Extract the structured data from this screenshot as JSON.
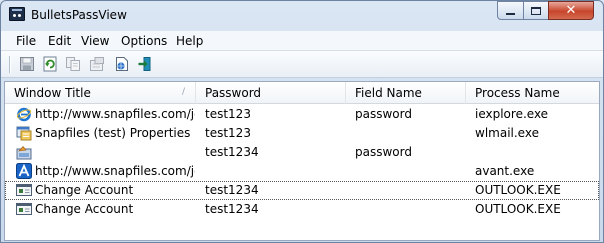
{
  "window": {
    "title": "BulletsPassView"
  },
  "title_controls": {
    "close_glyph": "✕"
  },
  "menu": [
    "File",
    "Edit",
    "View",
    "Options",
    "Help"
  ],
  "toolbar": {
    "buttons": [
      "save-icon",
      "refresh-icon",
      "copy-icon",
      "properties-icon",
      "html-report-icon",
      "exit-icon"
    ]
  },
  "table": {
    "columns": [
      "Window Title",
      "Password",
      "Field Name",
      "Process Name"
    ],
    "sort_indicator": "/",
    "rows": [
      {
        "icon": "internet-explorer-icon",
        "title": "http://www.snapfiles.com/jo...",
        "password": "test123",
        "field": "password",
        "process": "iexplore.exe"
      },
      {
        "icon": "properties-window-icon",
        "title": "Snapfiles (test) Properties",
        "password": "test123",
        "field": "",
        "process": "wlmail.exe"
      },
      {
        "icon": "generic-app-icon",
        "title": "",
        "password": "test1234",
        "field": "password",
        "process": ""
      },
      {
        "icon": "avant-browser-icon",
        "title": "http://www.snapfiles.com/jo...",
        "password": "",
        "field": "",
        "process": "avant.exe"
      },
      {
        "icon": "dialog-window-icon",
        "title": "Change Account",
        "password": "test1234",
        "field": "",
        "process": "OUTLOOK.EXE"
      },
      {
        "icon": "dialog-window-icon",
        "title": "Change Account",
        "password": "test1234",
        "field": "",
        "process": "OUTLOOK.EXE"
      }
    ]
  }
}
